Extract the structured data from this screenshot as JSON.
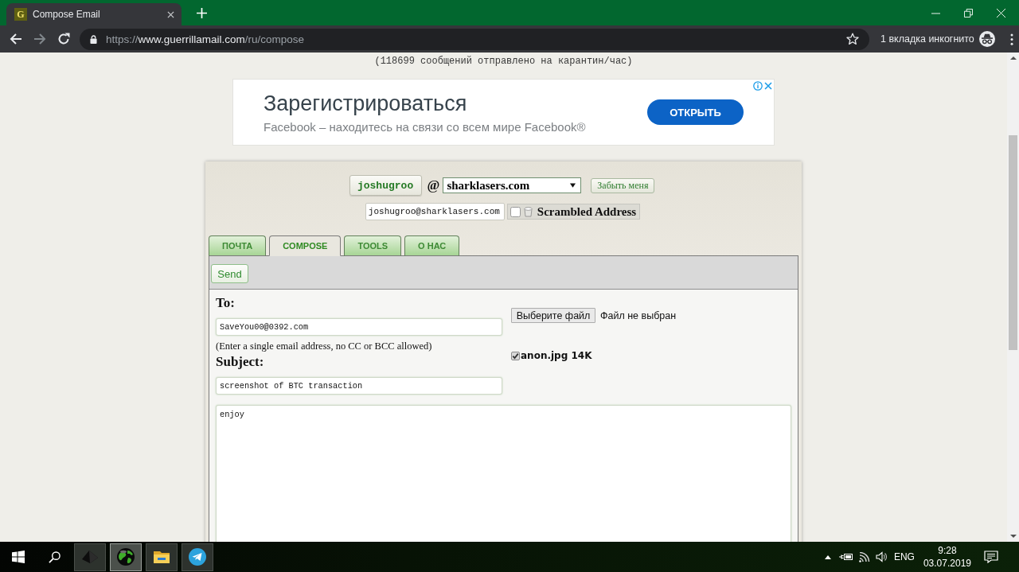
{
  "browser": {
    "tabs": [
      {
        "favicon_text": "G",
        "title": "Compose Email",
        "selected": true
      }
    ],
    "forward_disabled": true,
    "url": [
      {
        "text": "https://",
        "kind": "scheme"
      },
      {
        "text": "www.guerrillamail.com",
        "kind": "host"
      },
      {
        "text": "/ru/compose",
        "kind": "path"
      }
    ],
    "incognito_label": "1 вкладка инкогнито"
  },
  "page": {
    "quarantine_note": "(118699 сообщений отправлено на карантин/час)",
    "ad": {
      "headline": "Зарегистрироваться",
      "text": "Facebook – находитесь на связи со всем мире Facebook®",
      "button": "ОТКРЫТЬ"
    }
  },
  "account": {
    "username": "joshugroo",
    "at_sign": "@",
    "domain": "sharklasers.com",
    "forget_button": "Забыть меня",
    "address": "joshugroo@sharklasers.com",
    "scrambled": {
      "label": "Scrambled Address",
      "checked": false
    }
  },
  "tabs": [
    {
      "label": "ПОЧТА",
      "selected": false
    },
    {
      "label": "COMPOSE",
      "selected": true
    },
    {
      "label": "TOOLS",
      "selected": false
    },
    {
      "label": "О НАС",
      "selected": false
    }
  ],
  "compose": {
    "send_button": "Send",
    "to_label": "To:",
    "to_value": "SaveYou00@0392.com",
    "to_hint": "(Enter a single email address, no CC or BCC allowed)",
    "subject_label": "Subject:",
    "subject_value": "screenshot of BTC transaction",
    "body": "enjoy",
    "file_button": "Выберите файл",
    "file_status": "Файл не выбран",
    "attachments": [
      {
        "name": "anon.jpg 14K",
        "checked": true
      }
    ]
  },
  "taskbar": {
    "apps": [
      {
        "kind": "pyramid",
        "active": false
      },
      {
        "kind": "globe",
        "active": true
      },
      {
        "kind": "folder",
        "active": false
      },
      {
        "kind": "telegram",
        "active": false
      }
    ],
    "language": "ENG",
    "time": "9:28",
    "date": "03.07.2019"
  }
}
